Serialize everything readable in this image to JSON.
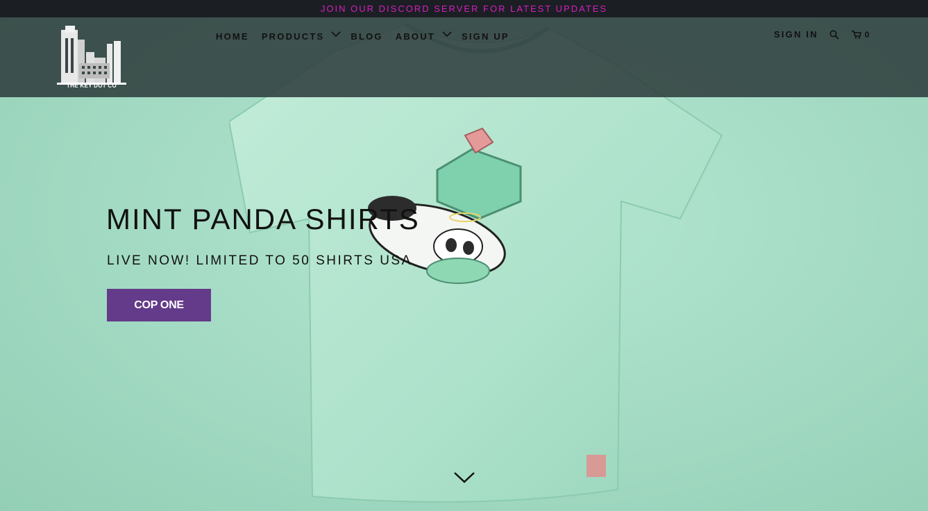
{
  "announcement": {
    "text": "JOIN OUR DISCORD SERVER FOR LATEST UPDATES"
  },
  "brand": {
    "name": "THE KEY DOT CO",
    "logo_icon": "building-skyline-logo"
  },
  "nav": {
    "items": [
      {
        "label": "HOME",
        "has_dropdown": false
      },
      {
        "label": "PRODUCTS",
        "has_dropdown": true
      },
      {
        "label": "BLOG",
        "has_dropdown": false
      },
      {
        "label": "ABOUT",
        "has_dropdown": true
      },
      {
        "label": "SIGN UP",
        "has_dropdown": false
      }
    ],
    "sign_in": "SIGN IN",
    "search_icon": "search-icon",
    "cart_icon": "cart-icon",
    "cart_count": "0"
  },
  "hero": {
    "title": "MINT PANDA SHIRTS",
    "subtitle": "LIVE NOW! LIMITED TO 50 SHIRTS USA",
    "cta_label": "COP ONE",
    "scroll_icon": "chevron-down-icon"
  },
  "colors": {
    "announcement_bg": "#1b1f23",
    "announcement_text": "#d61fc2",
    "header_overlay": "#2c3a3a",
    "hero_bg": "#a6dcc6",
    "cta_bg": "#643b8a",
    "cta_text": "#ffffff"
  }
}
